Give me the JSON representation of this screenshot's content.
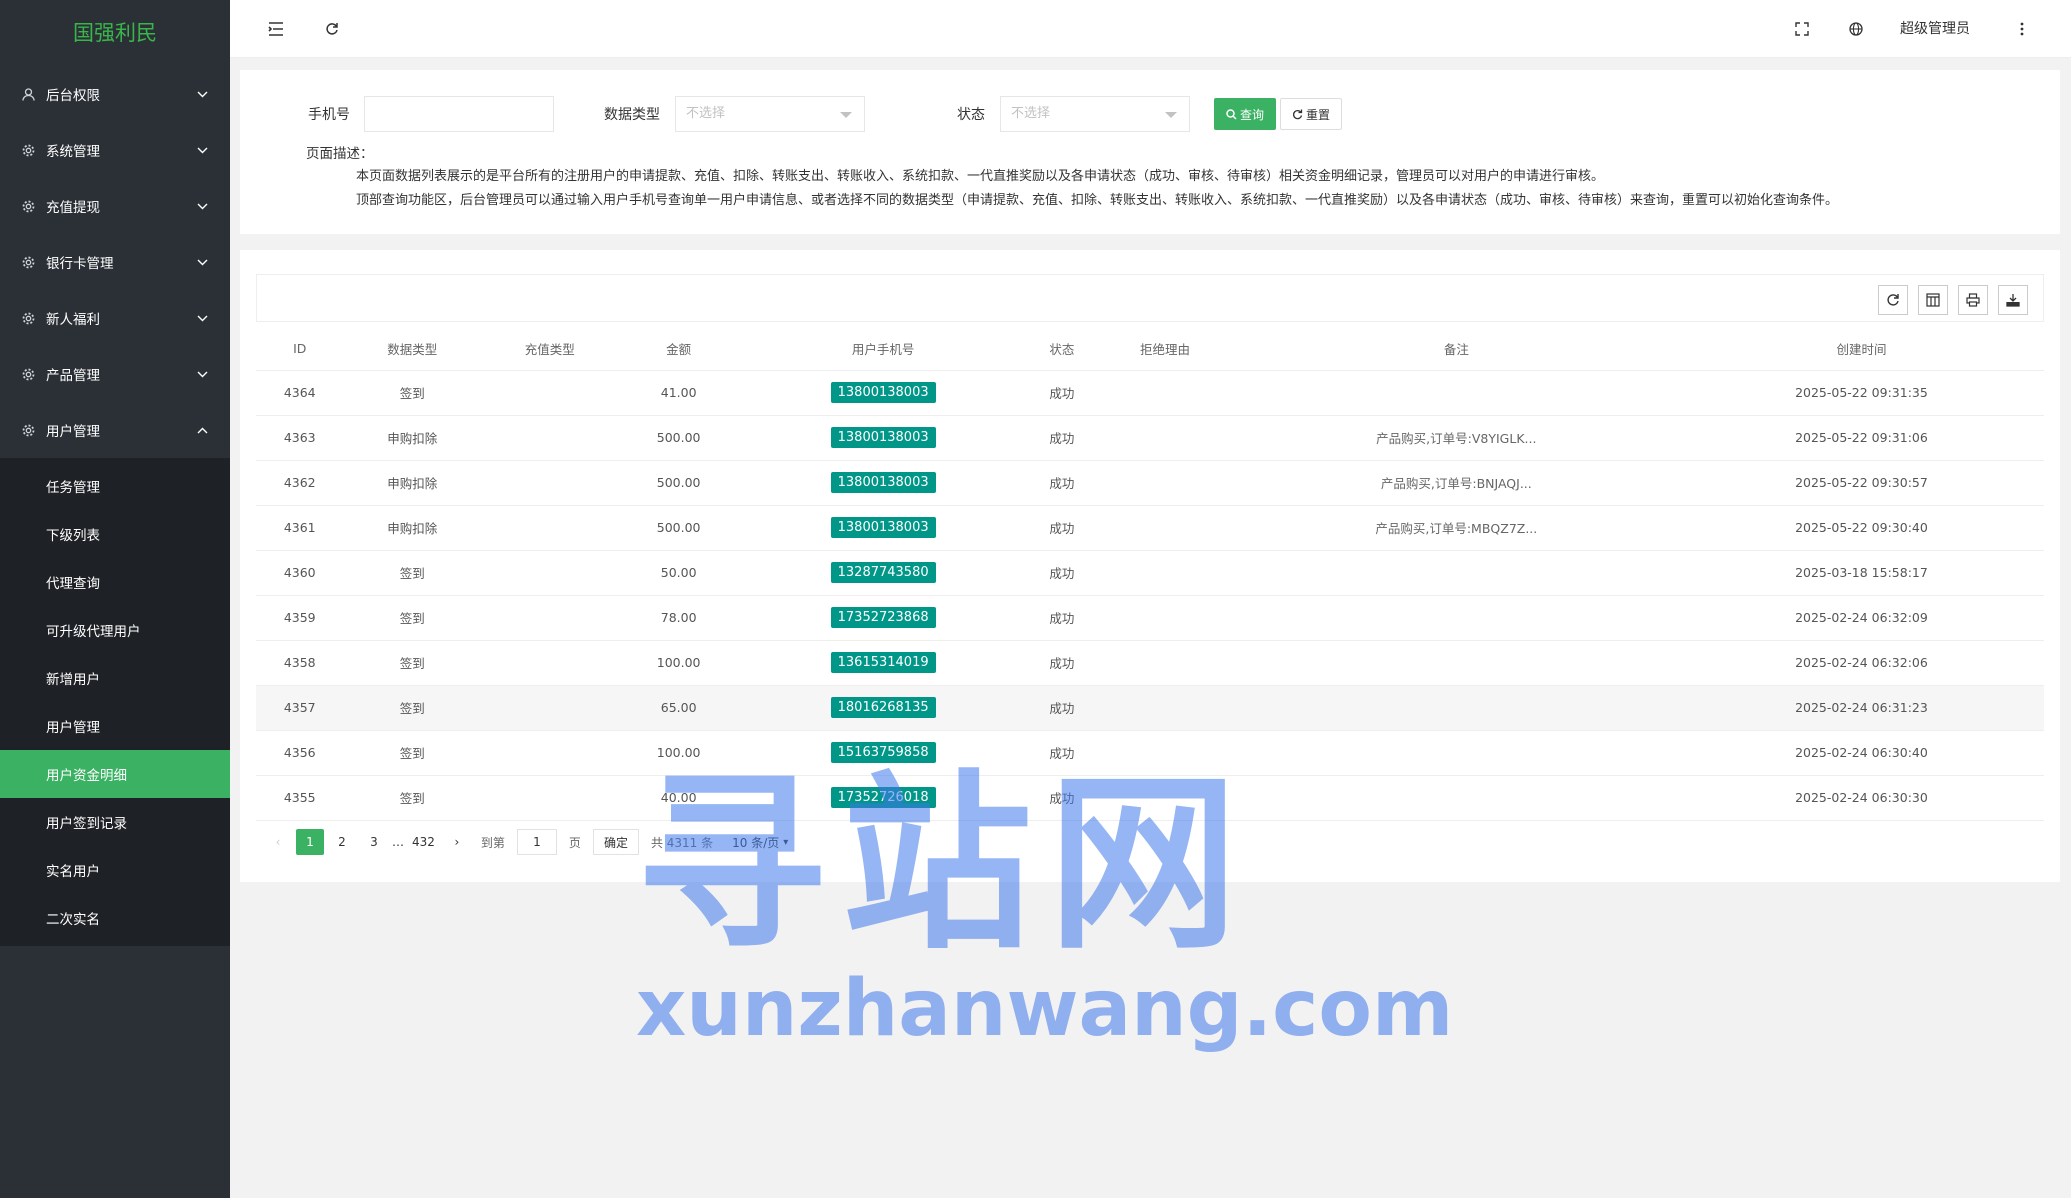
{
  "app": {
    "title": "国强利民"
  },
  "sidebar": {
    "items": [
      {
        "label": "后台权限",
        "icon": "user-icon"
      },
      {
        "label": "系统管理",
        "icon": "gear-icon"
      },
      {
        "label": "充值提现",
        "icon": "gear-icon"
      },
      {
        "label": "银行卡管理",
        "icon": "gear-icon"
      },
      {
        "label": "新人福利",
        "icon": "gear-icon"
      },
      {
        "label": "产品管理",
        "icon": "gear-icon"
      },
      {
        "label": "用户管理",
        "icon": "gear-icon"
      }
    ],
    "submenu": [
      {
        "label": "任务管理"
      },
      {
        "label": "下级列表"
      },
      {
        "label": "代理查询"
      },
      {
        "label": "可升级代理用户"
      },
      {
        "label": "新增用户"
      },
      {
        "label": "用户管理"
      },
      {
        "label": "用户资金明细"
      },
      {
        "label": "用户签到记录"
      },
      {
        "label": "实名用户"
      },
      {
        "label": "二次实名"
      }
    ]
  },
  "header": {
    "user": "超级管理员"
  },
  "filter": {
    "phone_label": "手机号",
    "phone_value": "",
    "type_label": "数据类型",
    "type_placeholder": "不选择",
    "status_label": "状态",
    "status_placeholder": "不选择",
    "search_label": "查询",
    "reset_label": "重置",
    "desc_title": "页面描述：",
    "desc_line1": "本页面数据列表展示的是平台所有的注册用户的申请提款、充值、扣除、转账支出、转账收入、系统扣款、一代直推奖励以及各申请状态（成功、审核、待审核）相关资金明细记录，管理员可以对用户的申请进行审核。",
    "desc_line2": "顶部查询功能区，后台管理员可以通过输入用户手机号查询单一用户申请信息、或者选择不同的数据类型（申请提款、充值、扣除、转账支出、转账收入、系统扣款、一代直推奖励）以及各申请状态（成功、审核、待审核）来查询，重置可以初始化查询条件。"
  },
  "table": {
    "columns": [
      "ID",
      "数据类型",
      "充值类型",
      "金额",
      "用户手机号",
      "状态",
      "拒绝理由",
      "备注",
      "创建时间"
    ],
    "rows": [
      {
        "id": "4364",
        "type": "签到",
        "recharge_type": "",
        "amount": "41.00",
        "phone": "13800138003",
        "status": "成功",
        "reason": "",
        "remark": "",
        "time": "2025-05-22 09:31:35"
      },
      {
        "id": "4363",
        "type": "申购扣除",
        "recharge_type": "",
        "amount": "500.00",
        "phone": "13800138003",
        "status": "成功",
        "reason": "",
        "remark": "产品购买,订单号:V8YIGLK...",
        "time": "2025-05-22 09:31:06"
      },
      {
        "id": "4362",
        "type": "申购扣除",
        "recharge_type": "",
        "amount": "500.00",
        "phone": "13800138003",
        "status": "成功",
        "reason": "",
        "remark": "产品购买,订单号:BNJAQJ...",
        "time": "2025-05-22 09:30:57"
      },
      {
        "id": "4361",
        "type": "申购扣除",
        "recharge_type": "",
        "amount": "500.00",
        "phone": "13800138003",
        "status": "成功",
        "reason": "",
        "remark": "产品购买,订单号:MBQZ7Z...",
        "time": "2025-05-22 09:30:40"
      },
      {
        "id": "4360",
        "type": "签到",
        "recharge_type": "",
        "amount": "50.00",
        "phone": "13287743580",
        "status": "成功",
        "reason": "",
        "remark": "",
        "time": "2025-03-18 15:58:17"
      },
      {
        "id": "4359",
        "type": "签到",
        "recharge_type": "",
        "amount": "78.00",
        "phone": "17352723868",
        "status": "成功",
        "reason": "",
        "remark": "",
        "time": "2025-02-24 06:32:09"
      },
      {
        "id": "4358",
        "type": "签到",
        "recharge_type": "",
        "amount": "100.00",
        "phone": "13615314019",
        "status": "成功",
        "reason": "",
        "remark": "",
        "time": "2025-02-24 06:32:06"
      },
      {
        "id": "4357",
        "type": "签到",
        "recharge_type": "",
        "amount": "65.00",
        "phone": "18016268135",
        "status": "成功",
        "reason": "",
        "remark": "",
        "time": "2025-02-24 06:31:23"
      },
      {
        "id": "4356",
        "type": "签到",
        "recharge_type": "",
        "amount": "100.00",
        "phone": "15163759858",
        "status": "成功",
        "reason": "",
        "remark": "",
        "time": "2025-02-24 06:30:40"
      },
      {
        "id": "4355",
        "type": "签到",
        "recharge_type": "",
        "amount": "40.00",
        "phone": "17352726018",
        "status": "成功",
        "reason": "",
        "remark": "",
        "time": "2025-02-24 06:30:30"
      }
    ]
  },
  "pager": {
    "pages": [
      "1",
      "2",
      "3",
      "…",
      "432"
    ],
    "goto_label": "到第",
    "goto_value": "1",
    "page_unit": "页",
    "confirm_label": "确定",
    "total": "共 4311 条",
    "limit": "10 条/页"
  },
  "watermark": {
    "cn": "寻站网",
    "en": "xunzhanwang.com"
  },
  "colors": {
    "accent": "#3bb263",
    "sidebar": "#2b3036",
    "badge": "#009688"
  }
}
